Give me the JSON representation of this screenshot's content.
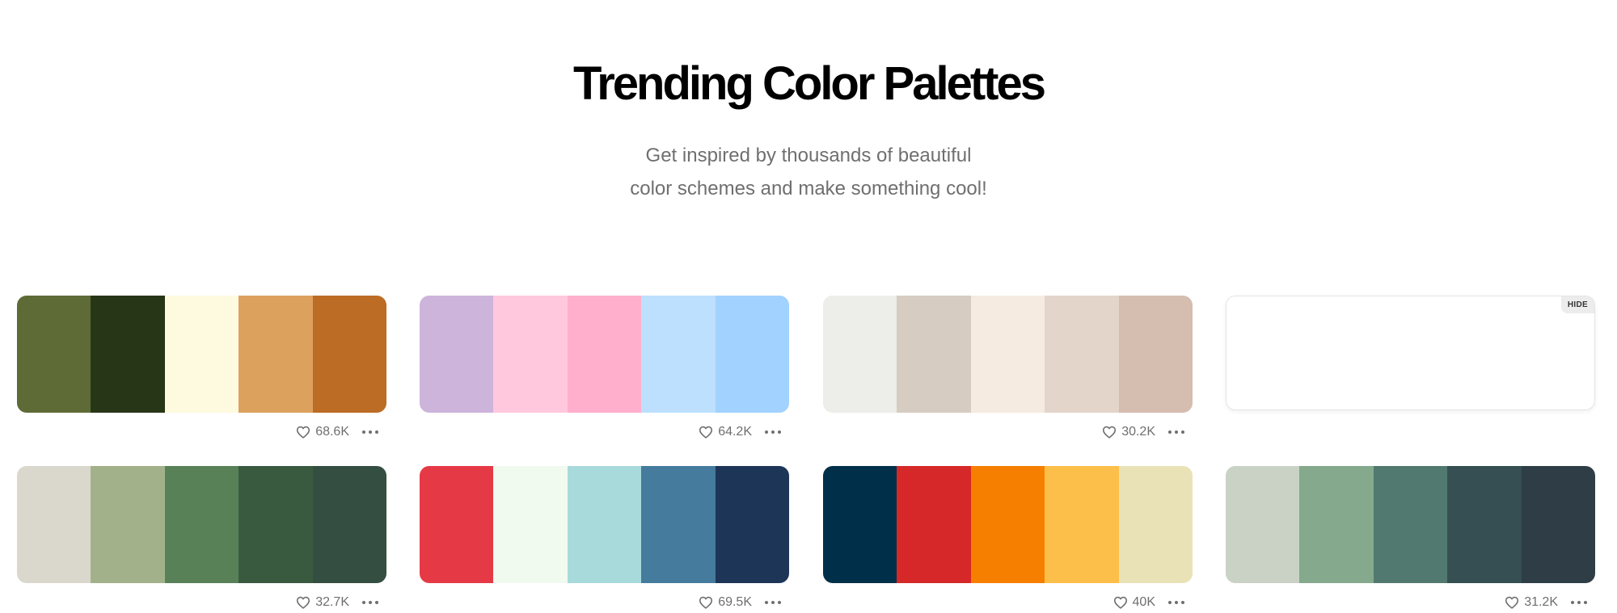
{
  "header": {
    "title": "Trending Color Palettes",
    "subtitle_line1": "Get inspired by thousands of beautiful",
    "subtitle_line2": "color schemes and make something cool!"
  },
  "palettes": [
    {
      "colors": [
        "#5e6b37",
        "#283618",
        "#fefae0",
        "#dda15e",
        "#bc6c25"
      ],
      "likes": "68.6K"
    },
    {
      "colors": [
        "#cdb4db",
        "#ffc8dd",
        "#ffafcc",
        "#bde0fe",
        "#a2d2ff"
      ],
      "likes": "64.2K"
    },
    {
      "colors": [
        "#edede9",
        "#d6ccc2",
        "#f5ebe0",
        "#e3d5ca",
        "#d5bdaf"
      ],
      "likes": "30.2K"
    },
    {
      "colors": [
        "#dad7cd",
        "#a3b18a",
        "#588157",
        "#3a5a40",
        "#344e41"
      ],
      "likes": "32.7K"
    },
    {
      "colors": [
        "#e63946",
        "#f1faee",
        "#a8dadc",
        "#457b9d",
        "#1d3557"
      ],
      "likes": "69.5K"
    },
    {
      "colors": [
        "#003049",
        "#d62828",
        "#f77f00",
        "#fcbf49",
        "#eae2b7"
      ],
      "likes": "40K"
    },
    {
      "colors": [
        "#cad2c5",
        "#84a98c",
        "#52796f",
        "#354f52",
        "#2f3e46"
      ],
      "likes": "31.2K"
    }
  ],
  "ad_slot": {
    "hide_label": "HIDE"
  },
  "icons": {
    "like": "heart-icon",
    "more": "more-dots-icon"
  }
}
